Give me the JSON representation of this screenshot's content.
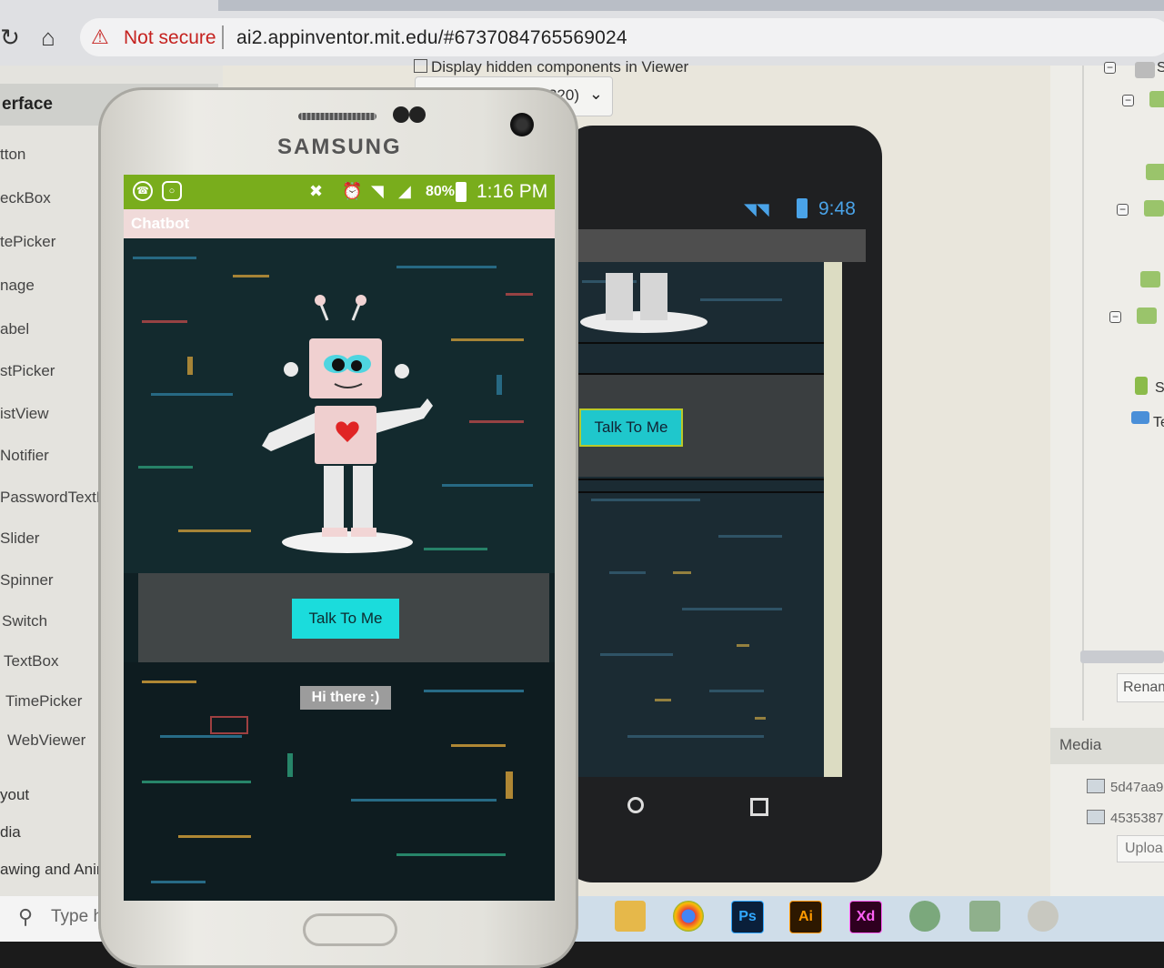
{
  "browser": {
    "security_label": "Not secure",
    "url": "ai2.appinventor.mit.edu/#6737084765569024"
  },
  "palette": {
    "header": "erface",
    "items": [
      "tton",
      "eckBox",
      "tePicker",
      "nage",
      "abel",
      "stPicker",
      "istView",
      "Notifier",
      "PasswordTextBox",
      "Slider",
      "Spinner",
      "Switch",
      "TextBox",
      "TimePicker",
      "WebViewer"
    ],
    "categories": [
      "yout",
      "dia",
      "awing and Animati"
    ],
    "search_placeholder": "Type here"
  },
  "viewer": {
    "hidden_components_label": "Display hidden components in Viewer",
    "size_select_value": "320)"
  },
  "designer_phone": {
    "time": "9:48",
    "button_label": "Talk To Me"
  },
  "components_panel": {
    "tree_labels": [
      "S",
      "S",
      "Te"
    ],
    "rename_label": "Renam",
    "media_header": "Media",
    "media_files": [
      "5d47aa9",
      "4535387"
    ],
    "upload_label": "Uploa"
  },
  "taskbar": {
    "apps": [
      {
        "name": "file-explorer",
        "label": ""
      },
      {
        "name": "chrome",
        "label": ""
      },
      {
        "name": "photoshop",
        "label": "Ps"
      },
      {
        "name": "illustrator",
        "label": "Ai"
      },
      {
        "name": "xd",
        "label": "Xd"
      }
    ]
  },
  "samsung_phone": {
    "brand": "SAMSUNG",
    "status": {
      "battery": "80%",
      "time": "1:16 PM"
    },
    "app_title": "Chatbot",
    "button_label": "Talk To Me",
    "greeting": "Hi there :)"
  },
  "colors": {
    "status_green": "#79ad1c",
    "button_cyan": "#1bdcdc",
    "security_red": "#c5221f",
    "android_blue": "#4aa3e8"
  }
}
